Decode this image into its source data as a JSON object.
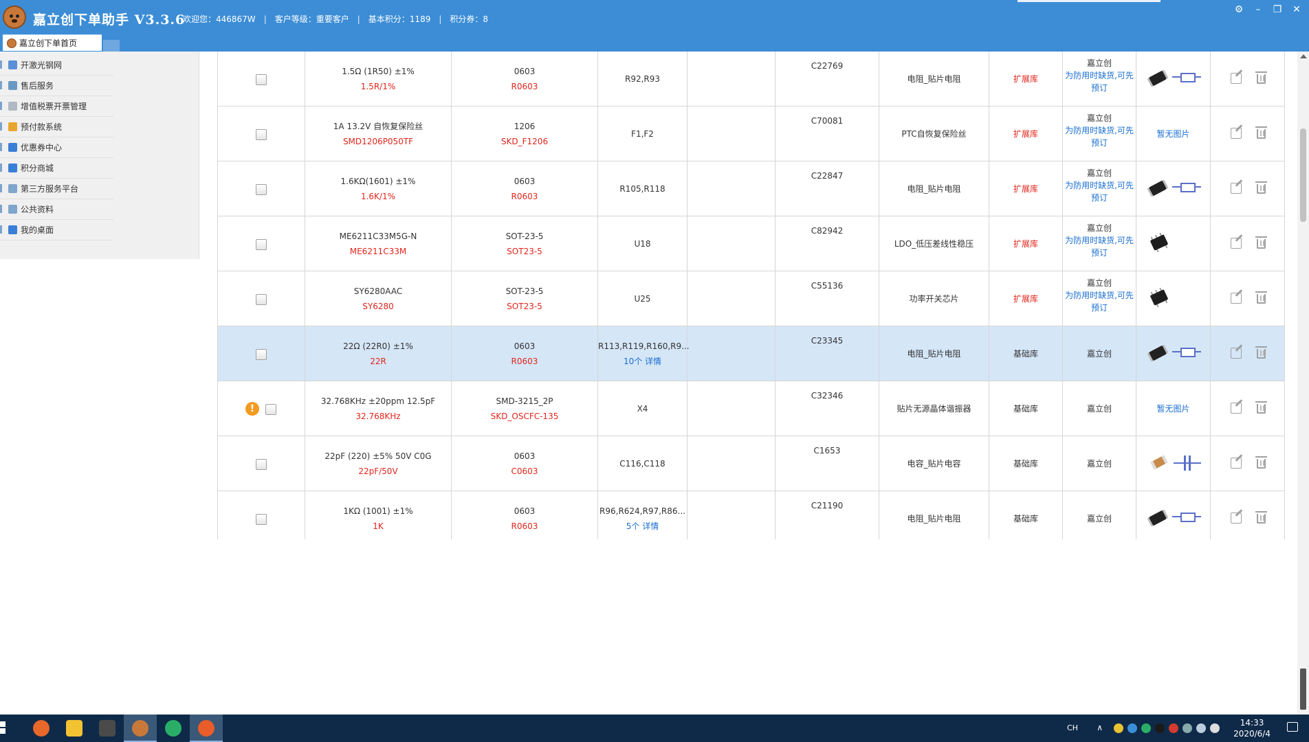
{
  "app": {
    "title": "嘉立创下单助手 V3.3.6",
    "welcome": "欢迎您：446867W",
    "customer_level": "客户等级：重要客户",
    "base_points": "基本积分：1189",
    "coupons": "积分券：8",
    "separator": "|"
  },
  "window_controls": {
    "settings": "⚙",
    "minimize": "–",
    "restore": "❐",
    "close": "✕"
  },
  "tabs": {
    "home": "嘉立创下单首页"
  },
  "sidebar": {
    "items": [
      {
        "label": "开激光钢网",
        "icon": "stencil-icon",
        "color": "#5b8fd6"
      },
      {
        "label": "售后服务",
        "icon": "support-icon",
        "color": "#6a9ac4"
      },
      {
        "label": "增值税票开票管理",
        "icon": "invoice-icon",
        "color": "#b0b8c4"
      },
      {
        "label": "预付款系统",
        "icon": "prepay-icon",
        "color": "#e8a530"
      },
      {
        "label": "优惠券中心",
        "icon": "coupon-icon",
        "color": "#3a7fd6"
      },
      {
        "label": "积分商城",
        "icon": "points-mall-icon",
        "color": "#3a7fd6"
      },
      {
        "label": "第三方服务平台",
        "icon": "third-party-icon",
        "color": "#7fa6cc"
      },
      {
        "label": "公共资料",
        "icon": "public-docs-icon",
        "color": "#7fa6cc"
      },
      {
        "label": "我的桌面",
        "icon": "desktop-icon",
        "color": "#3a7fd6"
      }
    ]
  },
  "rows": [
    {
      "value": "1.5Ω (1R50) ±1%",
      "value_code": "1.5R/1%",
      "package": "0603",
      "package_code": "R0603",
      "designator": "R92,R93",
      "designator_count": "",
      "designator_detail": "",
      "part_no": "C22769",
      "category": "电阻_贴片电阻",
      "library": "扩展库",
      "library_type": "ext",
      "vendor": "嘉立创",
      "vendor_note": "为防用时缺货,可先预订",
      "image": "resistor",
      "no_image_text": "",
      "warning": false,
      "selected": false
    },
    {
      "value": "1A 13.2V 自恢复保险丝",
      "value_code": "SMD1206P050TF",
      "package": "1206",
      "package_code": "SKD_F1206",
      "designator": "F1,F2",
      "designator_count": "",
      "designator_detail": "",
      "part_no": "C70081",
      "category": "PTC自恢复保险丝",
      "library": "扩展库",
      "library_type": "ext",
      "vendor": "嘉立创",
      "vendor_note": "为防用时缺货,可先预订",
      "image": "none",
      "no_image_text": "暂无图片",
      "warning": false,
      "selected": false
    },
    {
      "value": "1.6KΩ(1601) ±1%",
      "value_code": "1.6K/1%",
      "package": "0603",
      "package_code": "R0603",
      "designator": "R105,R118",
      "designator_count": "",
      "designator_detail": "",
      "part_no": "C22847",
      "category": "电阻_贴片电阻",
      "library": "扩展库",
      "library_type": "ext",
      "vendor": "嘉立创",
      "vendor_note": "为防用时缺货,可先预订",
      "image": "resistor",
      "no_image_text": "",
      "warning": false,
      "selected": false
    },
    {
      "value": "ME6211C33M5G-N",
      "value_code": "ME6211C33M",
      "package": "SOT-23-5",
      "package_code": "SOT23-5",
      "designator": "U18",
      "designator_count": "",
      "designator_detail": "",
      "part_no": "C82942",
      "category": "LDO_低压差线性稳压",
      "library": "扩展库",
      "library_type": "ext",
      "vendor": "嘉立创",
      "vendor_note": "为防用时缺货,可先预订",
      "image": "sot",
      "no_image_text": "",
      "warning": false,
      "selected": false
    },
    {
      "value": "SY6280AAC",
      "value_code": "SY6280",
      "package": "SOT-23-5",
      "package_code": "SOT23-5",
      "designator": "U25",
      "designator_count": "",
      "designator_detail": "",
      "part_no": "C55136",
      "category": "功率开关芯片",
      "library": "扩展库",
      "library_type": "ext",
      "vendor": "嘉立创",
      "vendor_note": "为防用时缺货,可先预订",
      "image": "sot",
      "no_image_text": "",
      "warning": false,
      "selected": false
    },
    {
      "value": "22Ω (22R0) ±1%",
      "value_code": "22R",
      "package": "0603",
      "package_code": "R0603",
      "designator": "R113,R119,R160,R9...",
      "designator_count": "10个",
      "designator_detail": "详情",
      "part_no": "C23345",
      "category": "电阻_贴片电阻",
      "library": "基础库",
      "library_type": "base",
      "vendor": "嘉立创",
      "vendor_note": "",
      "image": "resistor",
      "no_image_text": "",
      "warning": false,
      "selected": true
    },
    {
      "value": "32.768KHz ±20ppm 12.5pF",
      "value_code": "32.768KHz",
      "package": "SMD-3215_2P",
      "package_code": "SKD_OSCFC-135",
      "designator": "X4",
      "designator_count": "",
      "designator_detail": "",
      "part_no": "C32346",
      "category": "贴片无源晶体谐振器",
      "library": "基础库",
      "library_type": "base",
      "vendor": "嘉立创",
      "vendor_note": "",
      "image": "none",
      "no_image_text": "暂无图片",
      "warning": true,
      "selected": false
    },
    {
      "value": "22pF (220) ±5% 50V C0G",
      "value_code": "22pF/50V",
      "package": "0603",
      "package_code": "C0603",
      "designator": "C116,C118",
      "designator_count": "",
      "designator_detail": "",
      "part_no": "C1653",
      "category": "电容_贴片电容",
      "library": "基础库",
      "library_type": "base",
      "vendor": "嘉立创",
      "vendor_note": "",
      "image": "capacitor",
      "no_image_text": "",
      "warning": false,
      "selected": false
    },
    {
      "value": "1KΩ (1001) ±1%",
      "value_code": "1K",
      "package": "0603",
      "package_code": "R0603",
      "designator": "R96,R624,R97,R86...",
      "designator_count": "5个",
      "designator_detail": "详情",
      "part_no": "C21190",
      "category": "电阻_贴片电阻",
      "library": "基础库",
      "library_type": "base",
      "vendor": "嘉立创",
      "vendor_note": "",
      "image": "resistor",
      "no_image_text": "",
      "warning": false,
      "selected": false
    }
  ],
  "taskbar": {
    "apps": [
      {
        "name": "firefox",
        "color": "#e8672a",
        "active": false
      },
      {
        "name": "file-explorer",
        "color": "#f1c232",
        "active": false
      },
      {
        "name": "calculator",
        "color": "#4a4a4a",
        "active": false
      },
      {
        "name": "lceda-assistant",
        "color": "#c8793a",
        "active": true
      },
      {
        "name": "wechat",
        "color": "#2aae67",
        "active": false
      },
      {
        "name": "jlc-app",
        "color": "#e85d2a",
        "active": true
      }
    ],
    "ime": "CH",
    "caret": "∧",
    "time": "14:33",
    "date": "2020/6/4"
  },
  "colors": {
    "titlebar": "#3c8dd6",
    "ext_library": "#e0251b",
    "link": "#1a6fd0",
    "selected_row": "#d5e6f7"
  }
}
